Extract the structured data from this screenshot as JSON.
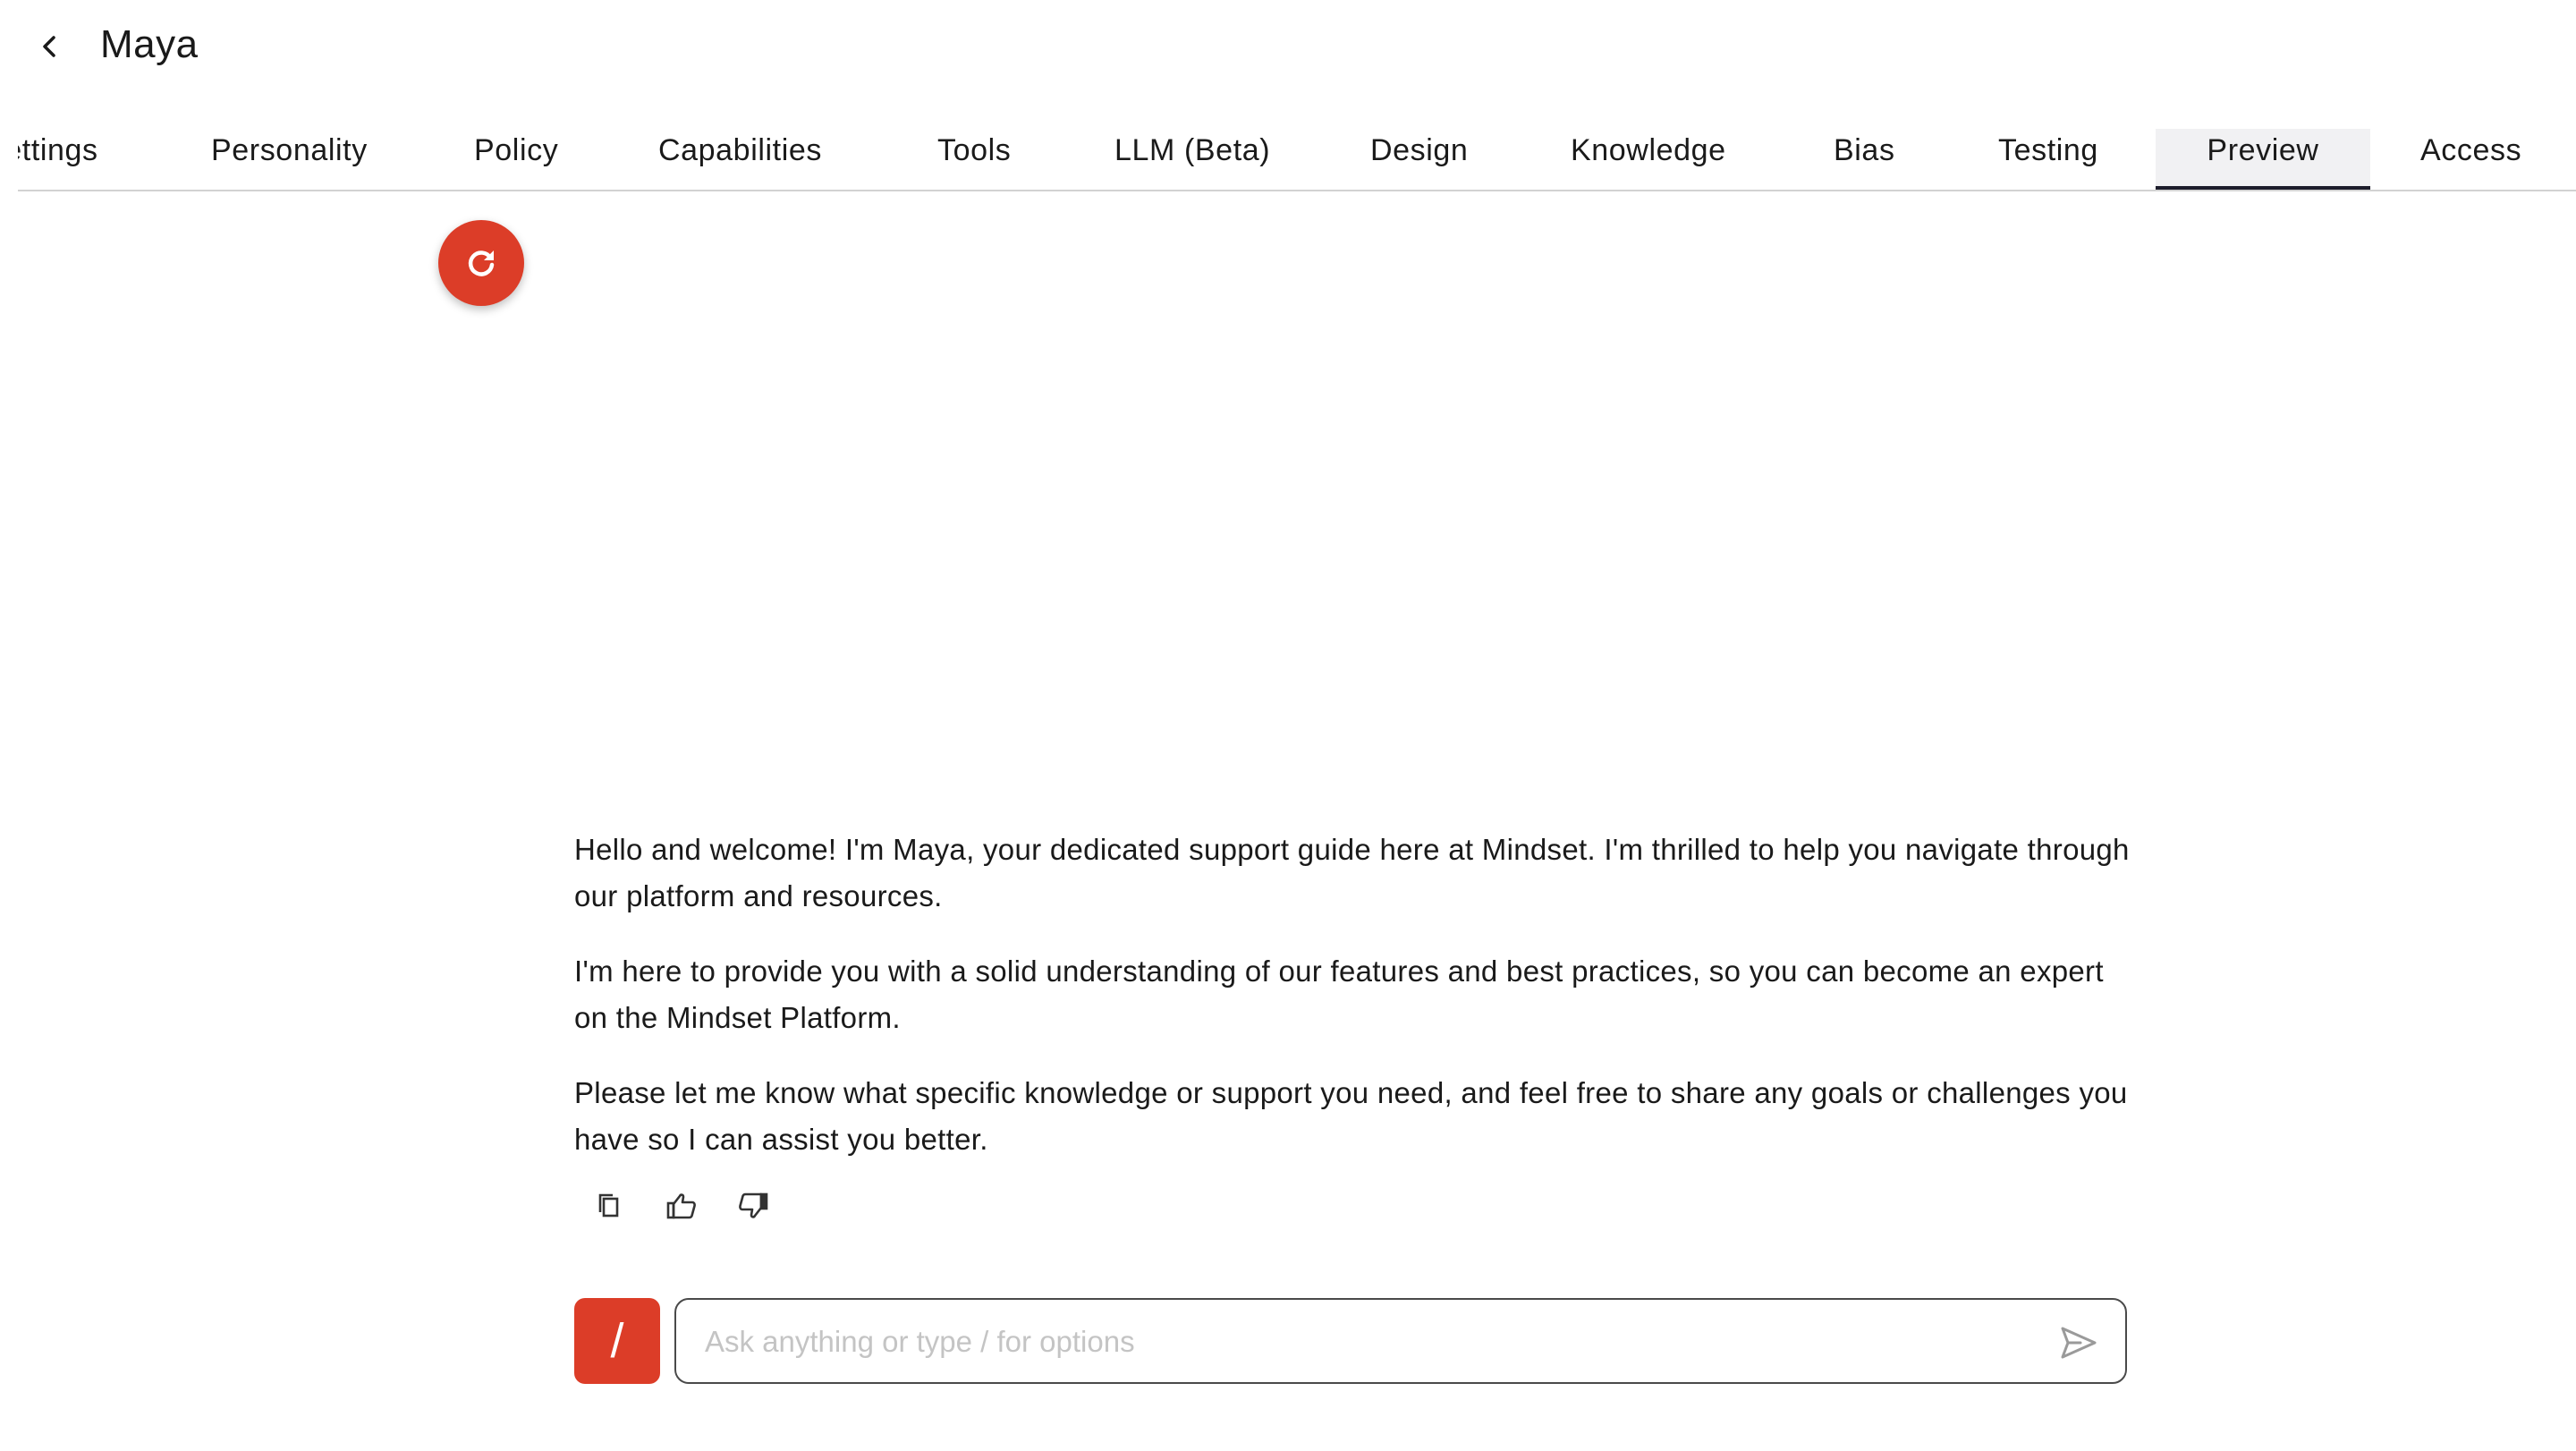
{
  "header": {
    "title": "Maya"
  },
  "tabs": [
    {
      "label": "Settings"
    },
    {
      "label": "Personality"
    },
    {
      "label": "Policy"
    },
    {
      "label": "Capabilities"
    },
    {
      "label": "Tools"
    },
    {
      "label": "LLM (Beta)"
    },
    {
      "label": "Design"
    },
    {
      "label": "Knowledge"
    },
    {
      "label": "Bias"
    },
    {
      "label": "Testing"
    },
    {
      "label": "Preview",
      "active": true
    },
    {
      "label": "Access"
    }
  ],
  "message": {
    "paragraphs": [
      "Hello and welcome! I'm Maya, your dedicated support guide here at Mindset. I'm thrilled to help you navigate through our platform and resources.",
      "I'm here to provide you with a solid understanding of our features and best practices, so you can become an expert on the Mindset Platform.",
      "Please let me know what specific knowledge or support you need, and feel free to share any goals or challenges you have so I can assist you better."
    ]
  },
  "composer": {
    "slash_label": "/",
    "placeholder": "Ask anything or type / for options",
    "value": ""
  },
  "icons": {
    "back": "chevron-left-icon",
    "refresh": "refresh-icon",
    "copy": "copy-icon",
    "like": "thumbs-up-icon",
    "dislike": "thumbs-down-icon",
    "send": "send-icon"
  },
  "colors": {
    "accent": "#dc3d28",
    "active_tab_bg": "#f1f1f3",
    "active_tab_underline": "#1d1d2b"
  }
}
